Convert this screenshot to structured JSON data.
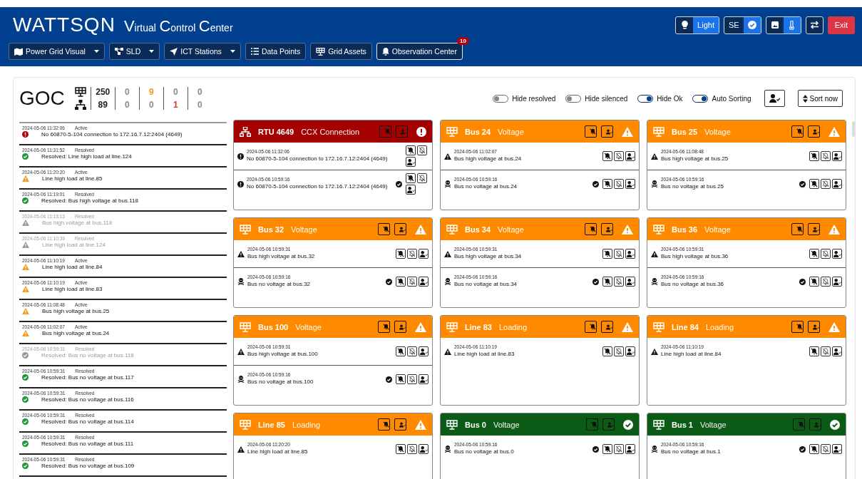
{
  "brand": {
    "logo": "WATTSQN",
    "title_parts": [
      {
        "cap": "V",
        "rest": "irtual"
      },
      {
        "cap": "C",
        "rest": "ontrol"
      },
      {
        "cap": "C",
        "rest": "enter"
      }
    ]
  },
  "nav": [
    {
      "label": "Power Grid Visual",
      "kind": "map",
      "dropdown": true,
      "selected": false
    },
    {
      "label": "SLD",
      "kind": "diagram",
      "dropdown": true,
      "selected": false
    },
    {
      "label": "ICT Stations",
      "kind": "send",
      "dropdown": true,
      "selected": false
    },
    {
      "label": "Data Points",
      "kind": "list",
      "dropdown": false,
      "selected": false
    },
    {
      "label": "Grid Assets",
      "kind": "grid",
      "dropdown": false,
      "selected": false
    },
    {
      "label": "Observation Center",
      "kind": "bell",
      "dropdown": false,
      "selected": true,
      "badge": "10"
    }
  ],
  "header_controls": {
    "theme": {
      "label": "Light",
      "on": true
    },
    "se": {
      "label": "SE",
      "on": true
    },
    "view": {
      "on": true
    },
    "exit": "Exit"
  },
  "summary": {
    "title": "GOC",
    "counts": [
      [
        {
          "value": "250",
          "color": "#222222"
        },
        {
          "value": "89",
          "color": "#222222"
        }
      ],
      [
        {
          "value": "0",
          "color": "#8a8a8a"
        },
        {
          "value": "0",
          "color": "#8a8a8a"
        }
      ],
      [
        {
          "value": "9",
          "color": "#f59a1c"
        },
        {
          "value": "0",
          "color": "#8a8a8a"
        }
      ],
      [
        {
          "value": "0",
          "color": "#8a8a8a"
        },
        {
          "value": "1",
          "color": "#d9342b"
        }
      ],
      [
        {
          "value": "0",
          "color": "#8a8a8a"
        },
        {
          "value": "0",
          "color": "#8a8a8a"
        }
      ]
    ]
  },
  "toggles": [
    {
      "label": "Hide resolved",
      "on": false
    },
    {
      "label": "Hide silenced",
      "on": false
    },
    {
      "label": "Hide Ok",
      "on": true
    },
    {
      "label": "Auto Sorting",
      "on": true
    }
  ],
  "sort_button": "Sort now",
  "event_log": [
    {
      "time": "2024-05-06 11:32:06",
      "status": "Active",
      "text": "No 60870-5-104 connection to 172.16.7.12:2404 (4649)",
      "kind": "error",
      "dimmed": false
    },
    {
      "time": "2024-05-06 11:31:52",
      "status": "Resolved",
      "text": "Resolved: Line high load at line.124",
      "kind": "ok",
      "dimmed": false
    },
    {
      "time": "2024-05-06 11:20:20",
      "status": "Active",
      "text": "Line high load at line.85",
      "kind": "warning",
      "dimmed": false
    },
    {
      "time": "2024-05-06 11:19:01",
      "status": "Resolved",
      "text": "Resolved: Bus high voltage at bus.118",
      "kind": "ok",
      "dimmed": false
    },
    {
      "time": "2024-05-06 11:13:13",
      "status": "Resolved",
      "text": "Bus high voltage at bus.118",
      "kind": "warning",
      "dimmed": true
    },
    {
      "time": "2024-05-06 11:10:39",
      "status": "Resolved",
      "text": "Line high load at line.124",
      "kind": "warning",
      "dimmed": true
    },
    {
      "time": "2024-05-06 11:10:19",
      "status": "Active",
      "text": "Line high load at line.84",
      "kind": "warning",
      "dimmed": false
    },
    {
      "time": "2024-05-06 11:10:19",
      "status": "Active",
      "text": "Line high load at line.83",
      "kind": "warning",
      "dimmed": false
    },
    {
      "time": "2024-05-06 11:08:48",
      "status": "Active",
      "text": "Bus high voltage at bus.25",
      "kind": "warning",
      "dimmed": false
    },
    {
      "time": "2024-05-06 11:02:07",
      "status": "Active",
      "text": "Bus high voltage at bus.24",
      "kind": "warning",
      "dimmed": false
    },
    {
      "time": "2024-05-06 10:59:31",
      "status": "Resolved",
      "text": "Resolved: Bus no voltage at bus.118",
      "kind": "ok",
      "dimmed": true
    },
    {
      "time": "2024-05-06 10:59:31",
      "status": "Resolved",
      "text": "Resolved: Bus no voltage at bus.117",
      "kind": "ok",
      "dimmed": false
    },
    {
      "time": "2024-05-06 10:59:31",
      "status": "Resolved",
      "text": "Resolved: Bus no voltage at bus.116",
      "kind": "ok",
      "dimmed": false
    },
    {
      "time": "2024-05-06 10:59:31",
      "status": "Resolved",
      "text": "Resolved: Bus no voltage at bus.114",
      "kind": "ok",
      "dimmed": false
    },
    {
      "time": "2024-05-06 10:59:31",
      "status": "Resolved",
      "text": "Resolved: Bus no voltage at bus.111",
      "kind": "ok",
      "dimmed": false
    },
    {
      "time": "2024-05-06 10:59:31",
      "status": "Resolved",
      "text": "Resolved: Bus no voltage at bus.109",
      "kind": "ok",
      "dimmed": false
    }
  ],
  "cards": [
    {
      "name": "RTU 4649",
      "type": "CCX Connection",
      "status": {
        "kind": "error"
      },
      "kind": "network",
      "events": [
        {
          "kind": "error",
          "time": "2024-05-06 11:32:06",
          "text": "No 60870-5-104 connection to 172.16.7.12:2404 (4649)",
          "acknowledged": false
        },
        {
          "kind": "error",
          "time": "2024-05-06 10:59:16",
          "text": "No 60870-5-104 connection to 172.16.7.12:2404 (4649)",
          "acknowledged": true
        }
      ]
    },
    {
      "name": "Bus 24",
      "type": "Voltage",
      "status": {
        "kind": "warning"
      },
      "kind": "grid",
      "events": [
        {
          "kind": "warning",
          "time": "2024-05-06 11:02:07",
          "text": "Bus high voltage at bus.24",
          "acknowledged": false
        },
        {
          "kind": "skull",
          "time": "2024-05-06 10:59:16",
          "text": "Bus no voltage at bus.24",
          "acknowledged": true
        }
      ]
    },
    {
      "name": "Bus 25",
      "type": "Voltage",
      "status": {
        "kind": "warning"
      },
      "kind": "grid",
      "events": [
        {
          "kind": "warning",
          "time": "2024-05-06 11:08:48",
          "text": "Bus high voltage at bus.25",
          "acknowledged": false
        },
        {
          "kind": "skull",
          "time": "2024-05-06 10:59:16",
          "text": "Bus no voltage at bus.25",
          "acknowledged": true
        }
      ]
    },
    {
      "name": "Bus 32",
      "type": "Voltage",
      "status": {
        "kind": "warning"
      },
      "kind": "grid",
      "events": [
        {
          "kind": "warning",
          "time": "2024-05-06 10:59:31",
          "text": "Bus high voltage at bus.32",
          "acknowledged": false
        },
        {
          "kind": "skull",
          "time": "2024-05-06 10:59:16",
          "text": "Bus no voltage at bus.32",
          "acknowledged": true
        }
      ]
    },
    {
      "name": "Bus 34",
      "type": "Voltage",
      "status": {
        "kind": "warning"
      },
      "kind": "grid",
      "events": [
        {
          "kind": "warning",
          "time": "2024-05-06 10:59:31",
          "text": "Bus high voltage at bus.34",
          "acknowledged": false
        },
        {
          "kind": "skull",
          "time": "2024-05-06 10:59:16",
          "text": "Bus no voltage at bus.34",
          "acknowledged": true
        }
      ]
    },
    {
      "name": "Bus 36",
      "type": "Voltage",
      "status": {
        "kind": "warning"
      },
      "kind": "grid",
      "events": [
        {
          "kind": "warning",
          "time": "2024-05-06 10:59:31",
          "text": "Bus high voltage at bus.36",
          "acknowledged": false
        },
        {
          "kind": "skull",
          "time": "2024-05-06 10:59:16",
          "text": "Bus no voltage at bus.36",
          "acknowledged": true
        }
      ]
    },
    {
      "name": "Bus 100",
      "type": "Voltage",
      "status": {
        "kind": "warning"
      },
      "kind": "grid",
      "events": [
        {
          "kind": "warning",
          "time": "2024-05-06 10:59:31",
          "text": "Bus high voltage at bus.100",
          "acknowledged": false
        },
        {
          "kind": "skull",
          "time": "2024-05-06 10:59:16",
          "text": "Bus no voltage at bus.100",
          "acknowledged": true
        }
      ]
    },
    {
      "name": "Line 83",
      "type": "Loading",
      "status": {
        "kind": "warning"
      },
      "kind": "grid",
      "events": [
        {
          "kind": "warning",
          "time": "2024-05-06 11:10:19",
          "text": "Line high load at line.83",
          "acknowledged": false
        }
      ]
    },
    {
      "name": "Line 84",
      "type": "Loading",
      "status": {
        "kind": "warning"
      },
      "kind": "grid",
      "events": [
        {
          "kind": "warning",
          "time": "2024-05-06 11:10:19",
          "text": "Line high load at line.84",
          "acknowledged": false
        }
      ]
    },
    {
      "name": "Line 85",
      "type": "Loading",
      "status": {
        "kind": "warning"
      },
      "kind": "grid",
      "events": [
        {
          "kind": "warning",
          "time": "2024-05-06 11:20:20",
          "text": "Line high load at line.85",
          "acknowledged": false
        }
      ]
    },
    {
      "name": "Bus 0",
      "type": "Voltage",
      "status": {
        "kind": "ok"
      },
      "kind": "grid",
      "events": [
        {
          "kind": "skull",
          "time": "2024-05-06 10:59:16",
          "text": "Bus no voltage at bus.0",
          "acknowledged": true
        }
      ]
    },
    {
      "name": "Bus 1",
      "type": "Voltage",
      "status": {
        "kind": "ok"
      },
      "kind": "grid",
      "events": [
        {
          "kind": "skull",
          "time": "2024-05-06 10:59:16",
          "text": "Bus no voltage at bus.1",
          "acknowledged": true
        }
      ]
    }
  ]
}
